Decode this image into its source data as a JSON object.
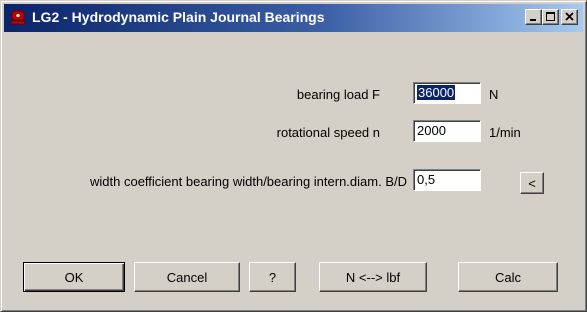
{
  "window": {
    "title": "LG2 - Hydrodynamic Plain Journal Bearings",
    "app_icon": "bearing-icon",
    "controls": [
      "minimize-icon",
      "maximize-icon",
      "close-icon"
    ]
  },
  "fields": {
    "load": {
      "label": "bearing load F",
      "value": "36000",
      "unit": "N"
    },
    "speed": {
      "label": "rotational speed n",
      "value": "2000",
      "unit": "1/min"
    },
    "width": {
      "label": "width coefficient bearing width/bearing intern.diam.  B/D",
      "value": "0,5",
      "unit_button": "<"
    }
  },
  "buttons": {
    "ok": "OK",
    "cancel": "Cancel",
    "help": "?",
    "convert": "N <--> lbf",
    "calc": "Calc"
  },
  "colors": {
    "title_start": "#0a246a",
    "title_end": "#a6caf0",
    "face": "#d4d0c8",
    "selection": "#0a246a",
    "icon_red": "#cc0000"
  }
}
